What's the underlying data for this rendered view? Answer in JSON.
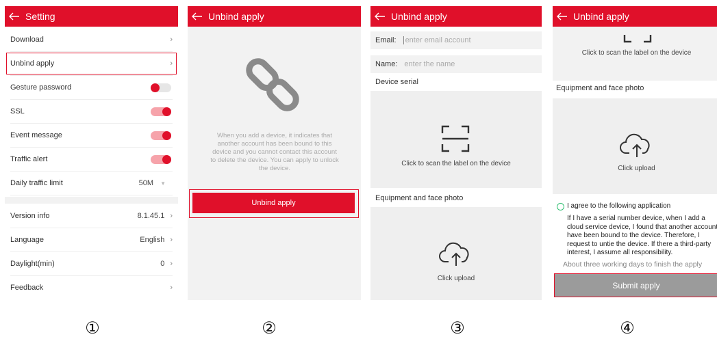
{
  "screens": {
    "s1": {
      "title": "Setting",
      "rows": [
        {
          "label": "Download"
        },
        {
          "label": "Unbind apply"
        },
        {
          "label": "Gesture password",
          "toggle": "off"
        },
        {
          "label": "SSL",
          "toggle": "on"
        },
        {
          "label": "Event message",
          "toggle": "on"
        },
        {
          "label": "Traffic alert",
          "toggle": "on"
        },
        {
          "label": "Daily traffic limit",
          "value": "50M"
        },
        {
          "label": "Version info",
          "value": "8.1.45.1"
        },
        {
          "label": "Language",
          "value": "English"
        },
        {
          "label": "Daylight(min)",
          "value": "0"
        },
        {
          "label": "Feedback"
        }
      ]
    },
    "s2": {
      "title": "Unbind apply",
      "info": "When you add a device, it indicates that another account has been bound to this device and you cannot contact this account to delete the device. You can apply to unlock the device.",
      "button": "Unbind apply"
    },
    "s3": {
      "title": "Unbind apply",
      "email_label": "Email:",
      "email_placeholder": "enter email account",
      "name_label": "Name:",
      "name_placeholder": "enter the name",
      "serial_label": "Device serial",
      "scan_text": "Click to scan the label on the device",
      "photo_label": "Equipment and face photo",
      "upload_text": "Click upload"
    },
    "s4": {
      "title": "Unbind apply",
      "scan_text": "Click to scan the label on the device",
      "photo_label": "Equipment and face photo",
      "upload_text": "Click upload",
      "agree_title": "I agree to the following application",
      "agree_body": "If I have a serial number device, when I add a cloud service device, I found that another account have been bound to the device. Therefore, I request to untie the device. If there a third-party interest, I assume all responsibility.",
      "days_note": "About three working days to finish the apply",
      "submit": "Submit apply"
    }
  },
  "step_numbers": [
    "①",
    "②",
    "③",
    "④"
  ],
  "colors": {
    "accent": "#e0102a",
    "toggle_on_track": "#f6a3aa",
    "agree_circle": "#2fbf71",
    "submit_bg": "#9b9b9b"
  }
}
